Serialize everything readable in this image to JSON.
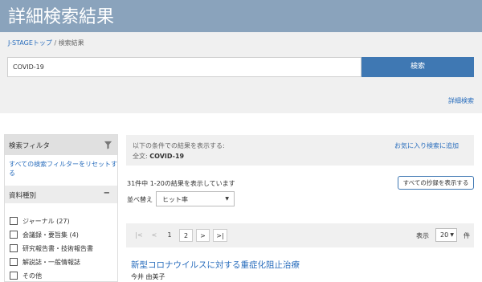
{
  "header": {
    "title": "詳細検索結果"
  },
  "breadcrumb": {
    "home": "J-STAGEトップ",
    "separator": "/",
    "current": "検索結果"
  },
  "search": {
    "query": "COVID-19",
    "button_label": "検索",
    "advanced_link": "詳細検索"
  },
  "filter": {
    "title": "検索フィルタ",
    "icon": "funnel-icon",
    "reset_label": "すべての検索フィルターをリセットする",
    "section_title": "資料種別",
    "collapse_symbol": "−",
    "options": [
      {
        "label": "ジャーナル (27)",
        "checked": false
      },
      {
        "label": "会議録・要旨集 (4)",
        "checked": false
      },
      {
        "label": "研究報告書・技術報告書",
        "checked": false
      },
      {
        "label": "解説誌・一般情報誌",
        "checked": false
      },
      {
        "label": "その他",
        "checked": false
      }
    ]
  },
  "conditions": {
    "heading": "以下の条件での結果を表示する:",
    "detail_label": "全文:",
    "detail_value": "COVID-19",
    "favorite_link": "お気に入り検索に追加"
  },
  "results": {
    "count_text": "31件中 1-20の結果を表示しています",
    "show_all_label": "すべての抄録を表示する",
    "sort_label": "並べ替え",
    "sort_value": "ヒット率"
  },
  "pagination": {
    "first": "|<",
    "prev": "<",
    "pages": [
      "1",
      "2"
    ],
    "current_page": "1",
    "next": ">",
    "last": ">|",
    "per_page_label": "表示",
    "per_page_value": "20",
    "per_page_unit": "件"
  },
  "items": [
    {
      "title": "新型コロナウイルスに対する重症化阻止治療",
      "author": "今井 由美子"
    }
  ],
  "colors": {
    "banner": "#8aa3bc",
    "accent": "#3f78b3",
    "link": "#2a6ebd"
  }
}
